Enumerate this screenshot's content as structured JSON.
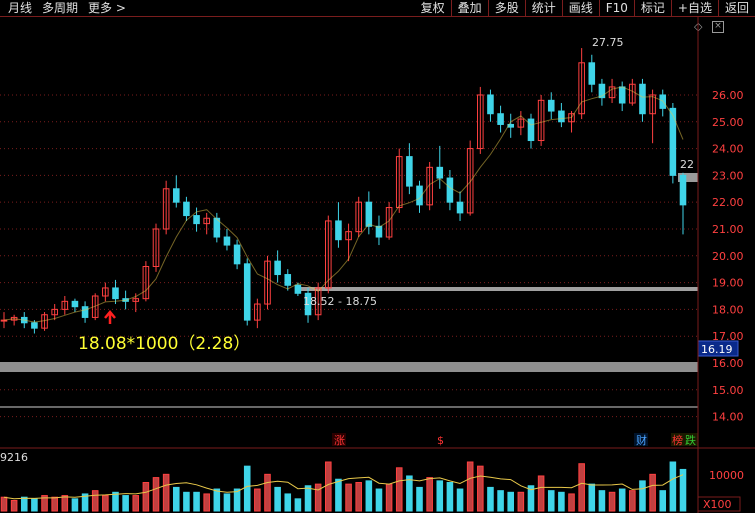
{
  "toolbar": {
    "left": [
      "月线",
      "多周期",
      "更多 >"
    ],
    "right": [
      "复权",
      "叠加",
      "多股",
      "统计",
      "画线",
      "F10",
      "标记",
      "+自选",
      "返回"
    ]
  },
  "icons": [
    "diamond-icon",
    "close-box-icon"
  ],
  "price_axis": {
    "labels": [
      "26.00",
      "25.00",
      "24.00",
      "23.00",
      "22.00",
      "21.00",
      "20.00",
      "19.00",
      "18.00",
      "17.00",
      "16.00",
      "15.00",
      "14.00"
    ],
    "current_price_badge": "16.19",
    "peak_label": "27.75",
    "right_edge_label": "22"
  },
  "annotations": {
    "cost_text": "18.08*1000（2.28）",
    "range_label": "18.52 - 18.75"
  },
  "event_markers": [
    {
      "label": "涨",
      "color": "#ff3333"
    },
    {
      "label": "$",
      "color": "#ff3333"
    },
    {
      "label": "财",
      "color": "#4aa3ff"
    },
    {
      "label": "榜",
      "color": "#ff3333"
    },
    {
      "label": "跌",
      "color": "#33cc33"
    }
  ],
  "volume_panel": {
    "left_label": "9216",
    "axis_label": "10000",
    "unit_label": "X100"
  },
  "colors": {
    "up": "#ff4040",
    "down": "#3fd4e8",
    "ma": "#e8c84a",
    "ma2": "#ffffff",
    "grid": "#7a1d1d",
    "axis_text": "#ff4040"
  },
  "chart_data": {
    "type": "candlestick",
    "ylim": [
      13.5,
      28.2
    ],
    "candles": [
      [
        17.6,
        17.9,
        17.3,
        17.6
      ],
      [
        17.6,
        17.8,
        17.4,
        17.7
      ],
      [
        17.7,
        17.9,
        17.3,
        17.5
      ],
      [
        17.5,
        17.6,
        17.1,
        17.3
      ],
      [
        17.3,
        17.9,
        17.2,
        17.8
      ],
      [
        17.8,
        18.2,
        17.6,
        18.0
      ],
      [
        18.0,
        18.5,
        17.8,
        18.3
      ],
      [
        18.3,
        18.4,
        17.9,
        18.1
      ],
      [
        18.1,
        18.3,
        17.5,
        17.7
      ],
      [
        17.7,
        18.6,
        17.6,
        18.5
      ],
      [
        18.5,
        19.0,
        18.3,
        18.8
      ],
      [
        18.8,
        19.1,
        18.2,
        18.4
      ],
      [
        18.4,
        18.7,
        18.0,
        18.3
      ],
      [
        18.3,
        18.6,
        17.9,
        18.4
      ],
      [
        18.4,
        19.8,
        18.3,
        19.6
      ],
      [
        19.6,
        21.2,
        19.4,
        21.0
      ],
      [
        21.0,
        22.8,
        20.8,
        22.5
      ],
      [
        22.5,
        23.0,
        21.8,
        22.0
      ],
      [
        22.0,
        22.2,
        21.3,
        21.5
      ],
      [
        21.5,
        21.8,
        20.9,
        21.2
      ],
      [
        21.2,
        21.6,
        20.8,
        21.4
      ],
      [
        21.4,
        21.6,
        20.5,
        20.7
      ],
      [
        20.7,
        21.0,
        20.2,
        20.4
      ],
      [
        20.4,
        20.6,
        19.5,
        19.7
      ],
      [
        19.7,
        19.9,
        17.4,
        17.6
      ],
      [
        17.6,
        18.4,
        17.3,
        18.2
      ],
      [
        18.2,
        20.0,
        18.0,
        19.8
      ],
      [
        19.8,
        20.2,
        19.0,
        19.3
      ],
      [
        19.3,
        19.5,
        18.7,
        18.9
      ],
      [
        18.9,
        19.0,
        18.5,
        18.6
      ],
      [
        18.6,
        18.8,
        17.5,
        17.8
      ],
      [
        17.8,
        19.0,
        17.6,
        18.8
      ],
      [
        18.8,
        21.5,
        18.6,
        21.3
      ],
      [
        21.3,
        22.0,
        20.3,
        20.6
      ],
      [
        20.6,
        21.2,
        19.8,
        20.9
      ],
      [
        20.9,
        22.2,
        20.7,
        22.0
      ],
      [
        22.0,
        22.4,
        20.8,
        21.1
      ],
      [
        21.1,
        21.5,
        20.4,
        20.7
      ],
      [
        20.7,
        22.0,
        20.6,
        21.8
      ],
      [
        21.8,
        24.0,
        21.6,
        23.7
      ],
      [
        23.7,
        24.2,
        22.3,
        22.6
      ],
      [
        22.6,
        22.8,
        21.6,
        21.9
      ],
      [
        21.9,
        23.5,
        21.7,
        23.3
      ],
      [
        23.3,
        24.1,
        22.5,
        22.9
      ],
      [
        22.9,
        23.2,
        21.7,
        22.0
      ],
      [
        22.0,
        22.4,
        21.3,
        21.6
      ],
      [
        21.6,
        24.3,
        21.5,
        24.0
      ],
      [
        24.0,
        26.3,
        23.8,
        26.0
      ],
      [
        26.0,
        26.2,
        25.0,
        25.3
      ],
      [
        25.3,
        25.6,
        24.6,
        24.9
      ],
      [
        24.9,
        25.3,
        24.4,
        24.8
      ],
      [
        24.8,
        25.4,
        24.5,
        25.1
      ],
      [
        25.1,
        25.3,
        24.0,
        24.3
      ],
      [
        24.3,
        26.0,
        24.1,
        25.8
      ],
      [
        25.8,
        26.1,
        25.1,
        25.4
      ],
      [
        25.4,
        25.7,
        24.8,
        25.0
      ],
      [
        25.0,
        25.4,
        24.6,
        25.3
      ],
      [
        25.3,
        27.75,
        25.1,
        27.2
      ],
      [
        27.2,
        27.5,
        26.1,
        26.4
      ],
      [
        26.4,
        26.6,
        25.6,
        25.9
      ],
      [
        25.9,
        26.6,
        25.7,
        26.3
      ],
      [
        26.3,
        26.5,
        25.4,
        25.7
      ],
      [
        25.7,
        26.6,
        25.6,
        26.4
      ],
      [
        26.4,
        26.6,
        25.0,
        25.3
      ],
      [
        25.3,
        26.2,
        24.2,
        26.0
      ],
      [
        26.0,
        26.2,
        25.2,
        25.5
      ],
      [
        25.5,
        25.7,
        22.7,
        23.0
      ],
      [
        23.0,
        23.1,
        20.8,
        21.9
      ]
    ]
  }
}
